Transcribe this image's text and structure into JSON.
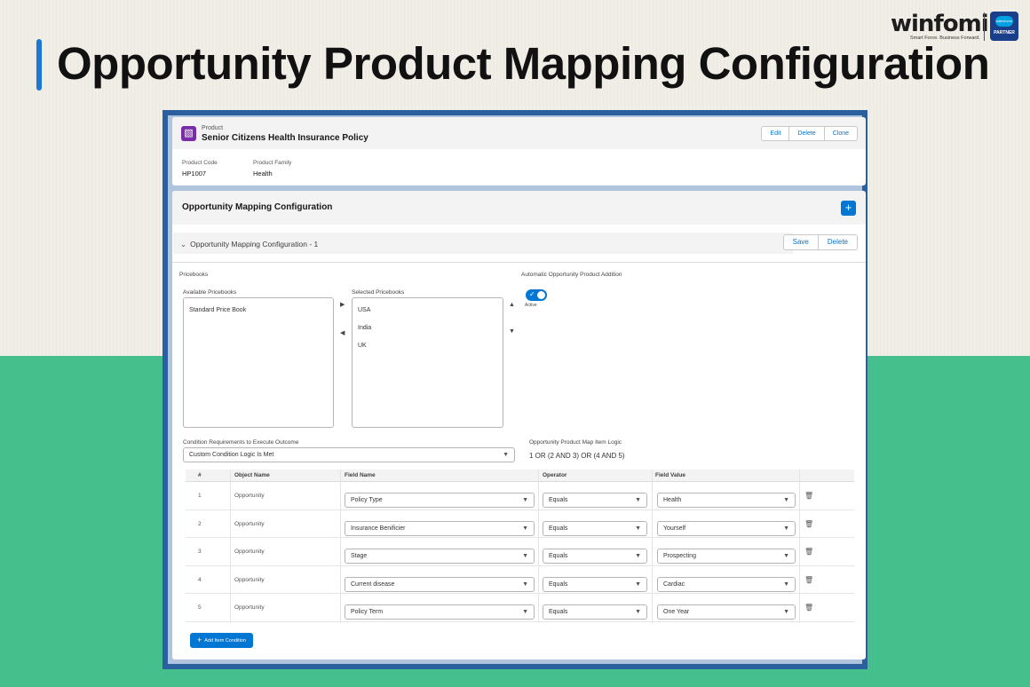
{
  "banner": {
    "title": "Opportunity Product Mapping Configuration",
    "logo_text": "winfomi",
    "logo_tagline": "Smart Force. Business Forward.",
    "badge_cloud": "salesforce",
    "badge_label": "PARTNER"
  },
  "product": {
    "object_type": "Product",
    "name": "Senior Citizens Health Insurance Policy",
    "actions": [
      "Edit",
      "Delete",
      "Clone"
    ],
    "fields": [
      {
        "label": "Product Code",
        "value": "HP1007"
      },
      {
        "label": "Product Family",
        "value": "Health"
      }
    ]
  },
  "config": {
    "title": "Opportunity Mapping Configuration",
    "add_icon": "plus-icon",
    "section_title": "Opportunity Mapping Configuration - 1",
    "save_label": "Save",
    "delete_label": "Delete",
    "pricebooks_label": "Pricebooks",
    "available_label": "Available Pricebooks",
    "available": [
      "Standard Price Book"
    ],
    "selected_label": "Selected Pricebooks",
    "selected": [
      "USA",
      "India",
      "UK"
    ],
    "auto_label": "Automatic Opportunity Product Addition",
    "auto_status": "Active",
    "auto_enabled": true,
    "condition_label": "Condition Requirements to Execute Outcome",
    "condition_value": "Custom Condition Logic Is Met",
    "logic_label": "Opportunity Product Map Item Logic",
    "logic_value": "1 OR (2 AND 3) OR (4 AND 5)"
  },
  "table": {
    "headers": [
      "#",
      "Object Name",
      "Field Name",
      "Operator",
      "Field Value"
    ],
    "rows": [
      {
        "num": "1",
        "object": "Opportunity",
        "field": "Policy Type",
        "operator": "Equals",
        "value": "Health"
      },
      {
        "num": "2",
        "object": "Opportunity",
        "field": "Insurance Benificier",
        "operator": "Equals",
        "value": "Yourself"
      },
      {
        "num": "3",
        "object": "Opportunity",
        "field": "Stage",
        "operator": "Equals",
        "value": "Prospecting"
      },
      {
        "num": "4",
        "object": "Opportunity",
        "field": "Current disease",
        "operator": "Equals",
        "value": "Cardiac"
      },
      {
        "num": "5",
        "object": "Opportunity",
        "field": "Policy Term",
        "operator": "Equals",
        "value": "One Year"
      }
    ],
    "add_label": "Add Item Condition"
  },
  "colors": {
    "brand_blue": "#0176d3",
    "frame_blue": "#2c5f9e",
    "accent_green": "#45bf8b",
    "product_icon": "#7a2ba8"
  }
}
